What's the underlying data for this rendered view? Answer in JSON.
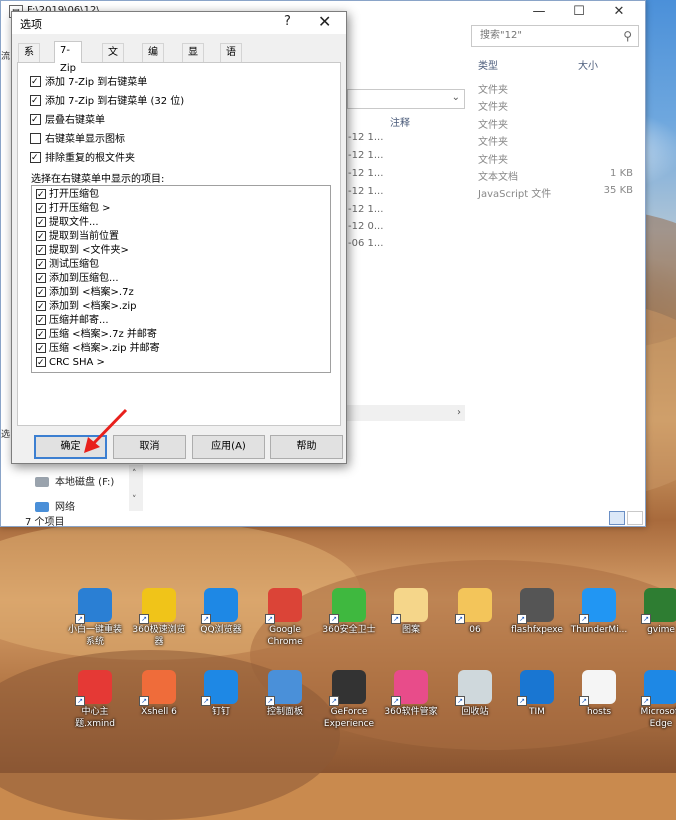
{
  "explorer": {
    "title": "F:\\2019\\06\\12\\",
    "search_placeholder": "搜索\"12\"",
    "col_type": "类型",
    "col_size": "大小",
    "col_note": "注释",
    "dates": [
      "-12 1...",
      "-12 1...",
      "-12 1...",
      "-12 1...",
      "-12 1...",
      "-12 0...",
      "-06 1..."
    ],
    "types": [
      "文件夹",
      "文件夹",
      "文件夹",
      "文件夹",
      "文件夹",
      "文本文档",
      "JavaScript 文件"
    ],
    "sizes": [
      "",
      "",
      "",
      "",
      "",
      "1 KB",
      "35 KB"
    ],
    "nav_local_disk": "本地磁盘 (F:)",
    "nav_network": "网络",
    "status": "7 个项目",
    "left_frag_1": "流",
    "left_frag_2": "选"
  },
  "dialog": {
    "title": "选项",
    "help": "?",
    "close": "✕",
    "tabs": [
      "系统",
      "7-Zip",
      "文件夹",
      "编辑器",
      "显示",
      "语言"
    ],
    "active_tab": "7-Zip",
    "options": [
      {
        "label": "添加 7-Zip 到右键菜单",
        "checked": true
      },
      {
        "label": "添加 7-Zip 到右键菜单 (32 位)",
        "checked": true
      },
      {
        "label": "层叠右键菜单",
        "checked": true
      },
      {
        "label": "右键菜单显示图标",
        "checked": false
      },
      {
        "label": "排除重复的根文件夹",
        "checked": true
      }
    ],
    "list_label": "选择在右键菜单中显示的项目:",
    "list_items": [
      {
        "label": "打开压缩包",
        "checked": true
      },
      {
        "label": "打开压缩包 >",
        "checked": true
      },
      {
        "label": "提取文件...",
        "checked": true
      },
      {
        "label": "提取到当前位置",
        "checked": true
      },
      {
        "label": "提取到 <文件夹>",
        "checked": true
      },
      {
        "label": "测试压缩包",
        "checked": true
      },
      {
        "label": "添加到压缩包...",
        "checked": true
      },
      {
        "label": "添加到 <档案>.7z",
        "checked": true
      },
      {
        "label": "添加到 <档案>.zip",
        "checked": true
      },
      {
        "label": "压缩并邮寄...",
        "checked": true
      },
      {
        "label": "压缩 <档案>.7z 并邮寄",
        "checked": true
      },
      {
        "label": "压缩 <档案>.zip 并邮寄",
        "checked": true
      },
      {
        "label": "CRC SHA >",
        "checked": true
      }
    ],
    "buttons": {
      "ok": "确定",
      "cancel": "取消",
      "apply": "应用(A)",
      "help": "帮助"
    }
  },
  "desktop": {
    "row1": [
      {
        "label": "小白一键重装系统",
        "icon": "xiaobai-icon",
        "color": "#2a7fd4"
      },
      {
        "label": "360极速浏览器",
        "icon": "360-browser-icon",
        "color": "#f0c419"
      },
      {
        "label": "QQ浏览器",
        "icon": "qq-browser-icon",
        "color": "#1e88e5"
      },
      {
        "label": "Google Chrome",
        "icon": "chrome-icon",
        "color": "#db4437"
      },
      {
        "label": "360安全卫士",
        "icon": "360-safe-icon",
        "color": "#3fb83f"
      },
      {
        "label": "图案",
        "icon": "folder-icon",
        "color": "#f5d68a"
      },
      {
        "label": "06",
        "icon": "folder-icon",
        "color": "#f3c55a"
      },
      {
        "label": "flashfxpexe",
        "icon": "flashfxp-icon",
        "color": "#555555"
      },
      {
        "label": "ThunderMi...",
        "icon": "thunder-icon",
        "color": "#2196f3"
      },
      {
        "label": "gvime",
        "icon": "vim-icon",
        "color": "#2e7d32"
      }
    ],
    "row2": [
      {
        "label": "中心主题.xmind",
        "icon": "xmind-icon",
        "color": "#e53935"
      },
      {
        "label": "Xshell 6",
        "icon": "xshell-icon",
        "color": "#ef6c3a"
      },
      {
        "label": "钉钉",
        "icon": "dingtalk-icon",
        "color": "#1e88e5"
      },
      {
        "label": "控制面板",
        "icon": "control-panel-icon",
        "color": "#4a90d9"
      },
      {
        "label": "GeForce Experience",
        "icon": "geforce-icon",
        "color": "#333333"
      },
      {
        "label": "360软件管家",
        "icon": "360-softmgr-icon",
        "color": "#e84c8a"
      },
      {
        "label": "回收站",
        "icon": "recycle-bin-icon",
        "color": "#cfd8dc"
      },
      {
        "label": "TIM",
        "icon": "tim-icon",
        "color": "#1976d2"
      },
      {
        "label": "hosts",
        "icon": "file-icon",
        "color": "#f5f5f5"
      },
      {
        "label": "Microsoft Edge",
        "icon": "edge-icon",
        "color": "#1e88e5"
      }
    ]
  }
}
